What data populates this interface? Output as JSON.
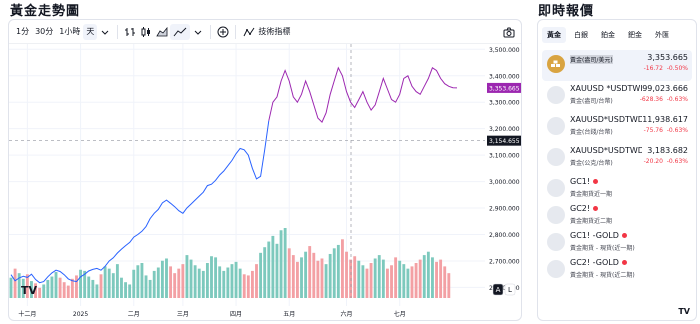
{
  "page": {
    "left_title": "黃金走勢圖",
    "right_title": "即時報價"
  },
  "toolbar": {
    "intervals": [
      "1分",
      "30分",
      "1小時",
      "天"
    ],
    "active_interval": "天",
    "indicators_label": "技術指標"
  },
  "chart_data": {
    "type": "line",
    "title": "",
    "xlabel": "",
    "ylabel": "",
    "ylim": [
      2560,
      3520
    ],
    "y_ticks": [
      2600,
      2700,
      2800,
      2900,
      3000,
      3100,
      3200,
      3300,
      3400,
      3500
    ],
    "x_ticks": [
      "十二月",
      "2025",
      "二月",
      "三月",
      "四月",
      "五月",
      "六月",
      "七月"
    ],
    "price_label": "3,353.665",
    "crosshair_label": "3,154.655",
    "crosshair_value": 3154.655,
    "series_price": [
      2648,
      2625,
      2636,
      2642,
      2638,
      2650,
      2630,
      2618,
      2622,
      2640,
      2655,
      2665,
      2660,
      2648,
      2632,
      2625,
      2622,
      2640,
      2650,
      2662,
      2668,
      2672,
      2665,
      2680,
      2700,
      2712,
      2730,
      2745,
      2758,
      2770,
      2790,
      2800,
      2812,
      2830,
      2860,
      2880,
      2895,
      2920,
      2930,
      2918,
      2905,
      2890,
      2880,
      2900,
      2915,
      2930,
      2945,
      2960,
      2985,
      2990,
      3005,
      3025,
      3040,
      3060,
      3080,
      3105,
      3125,
      3120,
      3100,
      3050,
      3010,
      3020,
      3120,
      3230,
      3300,
      3320,
      3380,
      3420,
      3380,
      3320,
      3300,
      3330,
      3380,
      3340,
      3290,
      3240,
      3225,
      3260,
      3330,
      3380,
      3430,
      3400,
      3340,
      3300,
      3280,
      3310,
      3340,
      3300,
      3270,
      3290,
      3340,
      3390,
      3350,
      3310,
      3300,
      3330,
      3390,
      3400,
      3360,
      3340,
      3330,
      3360,
      3390,
      3430,
      3420,
      3390,
      3370,
      3360,
      3355,
      3354
    ],
    "color_break_index": 63,
    "volume_values": [
      18,
      26,
      22,
      17,
      21,
      15,
      13,
      9,
      12,
      16,
      19,
      23,
      18,
      14,
      11,
      17,
      20,
      25,
      24,
      19,
      16,
      12,
      21,
      28,
      26,
      22,
      30,
      18,
      14,
      12,
      25,
      29,
      31,
      20,
      16,
      24,
      27,
      33,
      35,
      28,
      22,
      26,
      30,
      38,
      34,
      29,
      26,
      24,
      31,
      37,
      36,
      28,
      24,
      27,
      30,
      32,
      26,
      21,
      20,
      24,
      30,
      40,
      45,
      50,
      55,
      48,
      60,
      62,
      44,
      38,
      32,
      36,
      41,
      46,
      40,
      33,
      35,
      30,
      39,
      44,
      47,
      52,
      41,
      34,
      37,
      33,
      29,
      26,
      31,
      35,
      38,
      34,
      26,
      29,
      36,
      33,
      30,
      26,
      28,
      31,
      34,
      38,
      41,
      36,
      32,
      34,
      28,
      22
    ],
    "volume_colors_up": "#7dc9bd",
    "volume_colors_down": "#f3a0a4",
    "line_color_before": "#2962ff",
    "line_color_after": "#9c27b0",
    "scale_buttons": [
      "A",
      "L"
    ]
  },
  "quotes": {
    "tabs": [
      "黃金",
      "白銀",
      "鉑金",
      "鈀金",
      "外匯"
    ],
    "active_tab": "黃金",
    "items": [
      {
        "name": "黃金(盎司/美元)",
        "sub": "",
        "price": "3,353.665",
        "change": "-16.72",
        "pct": "-0.50%",
        "icon": "gold-bars-icon"
      },
      {
        "name": "XAUUSD *USDTWI",
        "sub": "黃金(盎司/台幣)",
        "price": "99,023.666",
        "change": "-628.36",
        "pct": "-0.63%",
        "icon": "gold-icon"
      },
      {
        "name": "XAUUSD*USDTWD/",
        "sub": "黃金(台錢/台幣)",
        "price": "11,938.617",
        "change": "-75.76",
        "pct": "-0.63%",
        "icon": "gold-icon"
      },
      {
        "name": "XAUUSD*USDTWD/",
        "sub": "黃金(公克/台幣)",
        "price": "3,183.682",
        "change": "-20.20",
        "pct": "-0.63%",
        "icon": "gold-icon"
      },
      {
        "name": "GC1!",
        "sub": "黃金期貨近一期",
        "icon": "gold-icon"
      },
      {
        "name": "GC2!",
        "sub": "黃金期貨近二期",
        "icon": "gold-icon"
      },
      {
        "name": "GC1! -GOLD",
        "sub": "黃金期貨 - 現貨(近一期)",
        "icon": "gold-icon"
      },
      {
        "name": "GC2! -GOLD",
        "sub": "黃金期貨 - 現貨(近二期)",
        "icon": "gold-icon"
      }
    ]
  }
}
